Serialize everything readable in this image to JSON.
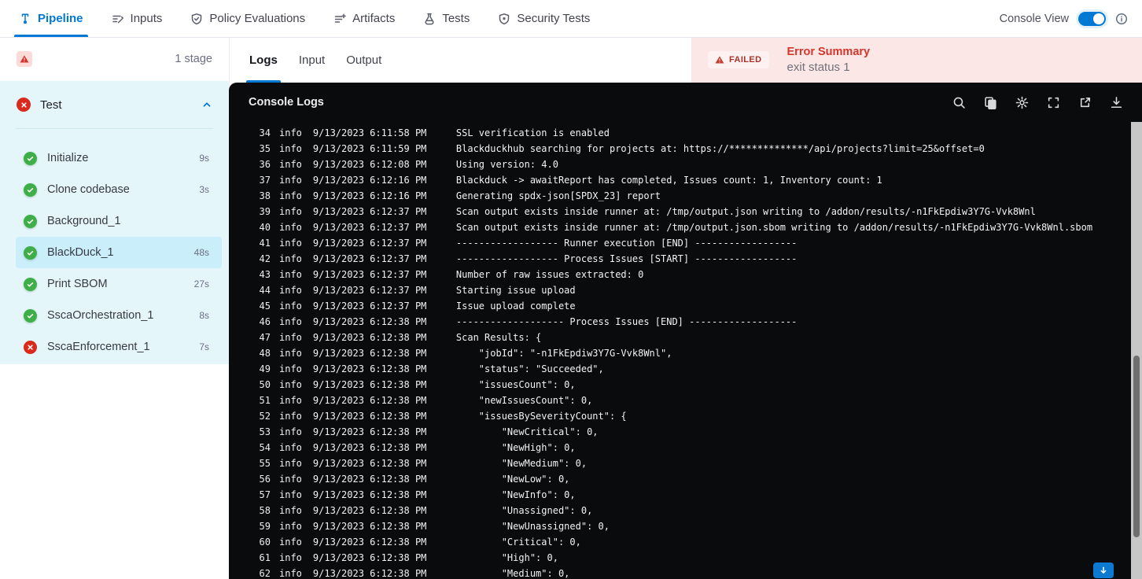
{
  "colors": {
    "accent": "#0278d5",
    "success": "#3fae49",
    "error": "#da291d",
    "sidebar_bg": "#e4f6fa",
    "selected_step_bg": "#cbeefb",
    "error_panel_bg": "#fbe7e6",
    "console_bg": "#0a0b0d"
  },
  "top_nav": {
    "tabs": [
      {
        "label": "Pipeline",
        "icon": "pipeline-icon",
        "active": true
      },
      {
        "label": "Inputs",
        "icon": "inputs-icon",
        "active": false
      },
      {
        "label": "Policy Evaluations",
        "icon": "policy-evaluations-icon",
        "active": false
      },
      {
        "label": "Artifacts",
        "icon": "artifacts-icon",
        "active": false
      },
      {
        "label": "Tests",
        "icon": "tests-icon",
        "active": false
      },
      {
        "label": "Security Tests",
        "icon": "security-tests-icon",
        "active": false
      }
    ],
    "console_view_label": "Console View",
    "console_view_on": true
  },
  "sidebar": {
    "stage_count": "1 stage",
    "stage": {
      "name": "Test",
      "status": "failed"
    },
    "steps": [
      {
        "name": "Initialize",
        "duration": "9s",
        "status": "success",
        "selected": false
      },
      {
        "name": "Clone codebase",
        "duration": "3s",
        "status": "success",
        "selected": false
      },
      {
        "name": "Background_1",
        "duration": "",
        "status": "success",
        "selected": false
      },
      {
        "name": "BlackDuck_1",
        "duration": "48s",
        "status": "success",
        "selected": true
      },
      {
        "name": "Print SBOM",
        "duration": "27s",
        "status": "success",
        "selected": false
      },
      {
        "name": "SscaOrchestration_1",
        "duration": "8s",
        "status": "success",
        "selected": false
      },
      {
        "name": "SscaEnforcement_1",
        "duration": "7s",
        "status": "failed",
        "selected": false
      }
    ]
  },
  "main": {
    "tabs": [
      {
        "label": "Logs",
        "active": true
      },
      {
        "label": "Input",
        "active": false
      },
      {
        "label": "Output",
        "active": false
      }
    ],
    "error_summary": {
      "badge": "FAILED",
      "title": "Error Summary",
      "message": "exit status 1"
    }
  },
  "console": {
    "title": "Console Logs",
    "icons": [
      "search-icon",
      "copy-icon",
      "settings-icon",
      "fullscreen-icon",
      "open-in-new-icon",
      "download-icon"
    ],
    "logs": [
      {
        "n": "34",
        "level": "info",
        "time": "9/13/2023 6:11:58 PM",
        "msg": "SSL verification is enabled"
      },
      {
        "n": "35",
        "level": "info",
        "time": "9/13/2023 6:11:59 PM",
        "msg": "Blackduckhub searching for projects at: https://**************/api/projects?limit=25&offset=0"
      },
      {
        "n": "36",
        "level": "info",
        "time": "9/13/2023 6:12:08 PM",
        "msg": "Using version: 4.0"
      },
      {
        "n": "37",
        "level": "info",
        "time": "9/13/2023 6:12:16 PM",
        "msg": "Blackduck -> awaitReport has completed, Issues count: 1, Inventory count: 1"
      },
      {
        "n": "38",
        "level": "info",
        "time": "9/13/2023 6:12:16 PM",
        "msg": "Generating spdx-json[SPDX_23] report"
      },
      {
        "n": "39",
        "level": "info",
        "time": "9/13/2023 6:12:37 PM",
        "msg": "Scan output exists inside runner at: /tmp/output.json writing to /addon/results/-n1FkEpdiw3Y7G-Vvk8Wnl"
      },
      {
        "n": "40",
        "level": "info",
        "time": "9/13/2023 6:12:37 PM",
        "msg": "Scan output exists inside runner at: /tmp/output.json.sbom writing to /addon/results/-n1FkEpdiw3Y7G-Vvk8Wnl.sbom"
      },
      {
        "n": "41",
        "level": "info",
        "time": "9/13/2023 6:12:37 PM",
        "msg": "------------------ Runner execution [END] ------------------"
      },
      {
        "n": "42",
        "level": "info",
        "time": "9/13/2023 6:12:37 PM",
        "msg": "------------------ Process Issues [START] ------------------"
      },
      {
        "n": "43",
        "level": "info",
        "time": "9/13/2023 6:12:37 PM",
        "msg": "Number of raw issues extracted: 0"
      },
      {
        "n": "44",
        "level": "info",
        "time": "9/13/2023 6:12:37 PM",
        "msg": "Starting issue upload"
      },
      {
        "n": "45",
        "level": "info",
        "time": "9/13/2023 6:12:37 PM",
        "msg": "Issue upload complete"
      },
      {
        "n": "46",
        "level": "info",
        "time": "9/13/2023 6:12:38 PM",
        "msg": "------------------- Process Issues [END] -------------------"
      },
      {
        "n": "47",
        "level": "info",
        "time": "9/13/2023 6:12:38 PM",
        "msg": "Scan Results: {"
      },
      {
        "n": "48",
        "level": "info",
        "time": "9/13/2023 6:12:38 PM",
        "msg": "    \"jobId\": \"-n1FkEpdiw3Y7G-Vvk8Wnl\","
      },
      {
        "n": "49",
        "level": "info",
        "time": "9/13/2023 6:12:38 PM",
        "msg": "    \"status\": \"Succeeded\","
      },
      {
        "n": "50",
        "level": "info",
        "time": "9/13/2023 6:12:38 PM",
        "msg": "    \"issuesCount\": 0,"
      },
      {
        "n": "51",
        "level": "info",
        "time": "9/13/2023 6:12:38 PM",
        "msg": "    \"newIssuesCount\": 0,"
      },
      {
        "n": "52",
        "level": "info",
        "time": "9/13/2023 6:12:38 PM",
        "msg": "    \"issuesBySeverityCount\": {"
      },
      {
        "n": "53",
        "level": "info",
        "time": "9/13/2023 6:12:38 PM",
        "msg": "        \"NewCritical\": 0,"
      },
      {
        "n": "54",
        "level": "info",
        "time": "9/13/2023 6:12:38 PM",
        "msg": "        \"NewHigh\": 0,"
      },
      {
        "n": "55",
        "level": "info",
        "time": "9/13/2023 6:12:38 PM",
        "msg": "        \"NewMedium\": 0,"
      },
      {
        "n": "56",
        "level": "info",
        "time": "9/13/2023 6:12:38 PM",
        "msg": "        \"NewLow\": 0,"
      },
      {
        "n": "57",
        "level": "info",
        "time": "9/13/2023 6:12:38 PM",
        "msg": "        \"NewInfo\": 0,"
      },
      {
        "n": "58",
        "level": "info",
        "time": "9/13/2023 6:12:38 PM",
        "msg": "        \"Unassigned\": 0,"
      },
      {
        "n": "59",
        "level": "info",
        "time": "9/13/2023 6:12:38 PM",
        "msg": "        \"NewUnassigned\": 0,"
      },
      {
        "n": "60",
        "level": "info",
        "time": "9/13/2023 6:12:38 PM",
        "msg": "        \"Critical\": 0,"
      },
      {
        "n": "61",
        "level": "info",
        "time": "9/13/2023 6:12:38 PM",
        "msg": "        \"High\": 0,"
      },
      {
        "n": "62",
        "level": "info",
        "time": "9/13/2023 6:12:38 PM",
        "msg": "        \"Medium\": 0,"
      }
    ]
  }
}
